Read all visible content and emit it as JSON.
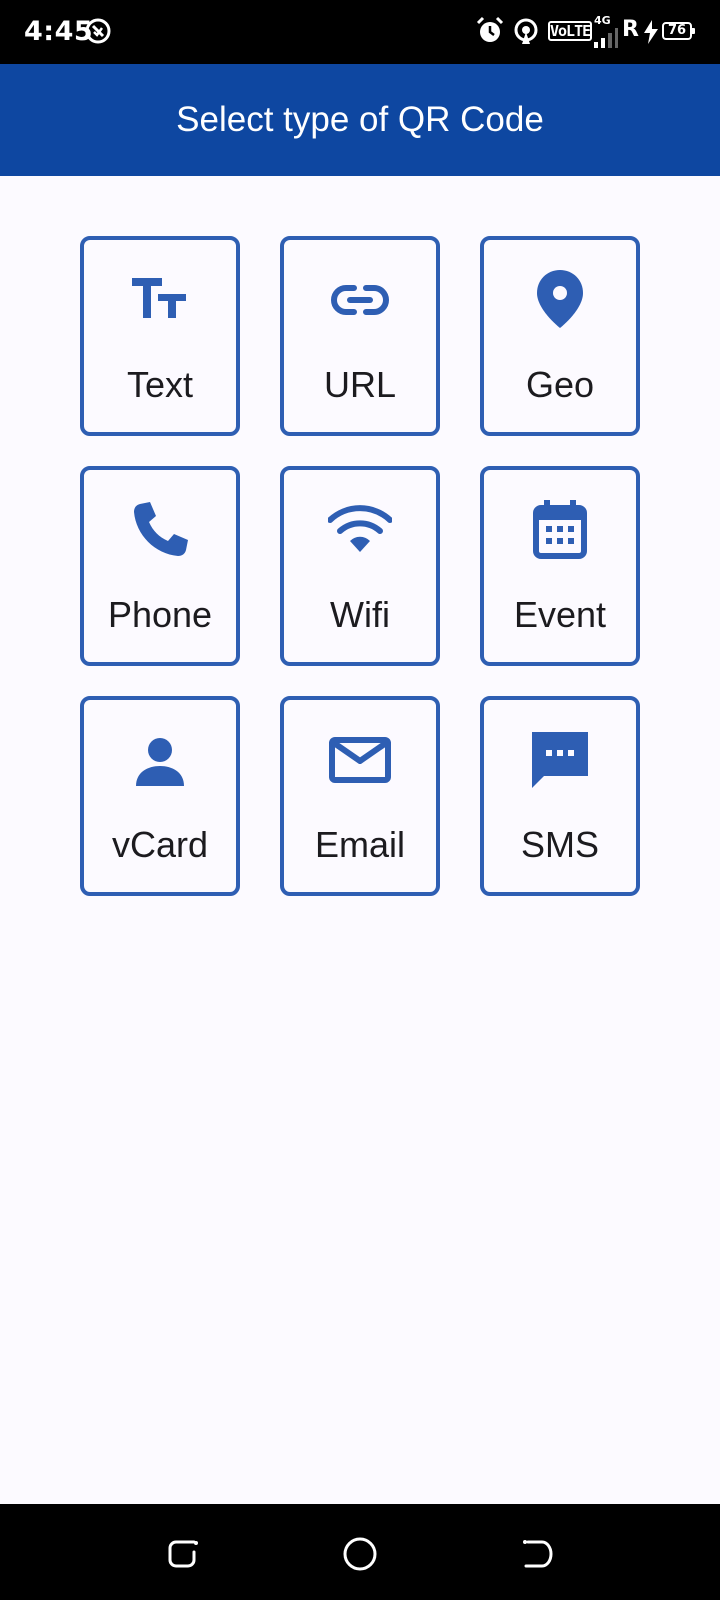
{
  "status_bar": {
    "time": "4:45",
    "icons": [
      "no-disturb-icon",
      "alarm-icon",
      "hotspot-icon",
      "volte-icon",
      "signal-icon",
      "roaming-icon",
      "charging-icon",
      "battery-icon"
    ],
    "volte_label": "VoLTE",
    "network_label": "4G",
    "roaming_label": "R",
    "battery_level": "76"
  },
  "app_bar": {
    "title": "Select type of QR Code",
    "color": "#0e47a1"
  },
  "accent_color": "#2e5eb3",
  "tiles": [
    {
      "label": "Text",
      "icon": "text-fields-icon"
    },
    {
      "label": "URL",
      "icon": "link-icon"
    },
    {
      "label": "Geo",
      "icon": "location-pin-icon"
    },
    {
      "label": "Phone",
      "icon": "phone-icon"
    },
    {
      "label": "Wifi",
      "icon": "wifi-icon"
    },
    {
      "label": "Event",
      "icon": "calendar-icon"
    },
    {
      "label": "vCard",
      "icon": "person-icon"
    },
    {
      "label": "Email",
      "icon": "mail-icon"
    },
    {
      "label": "SMS",
      "icon": "sms-icon"
    }
  ],
  "nav_bar": {
    "buttons": [
      "recents-icon",
      "home-icon",
      "back-icon"
    ]
  }
}
